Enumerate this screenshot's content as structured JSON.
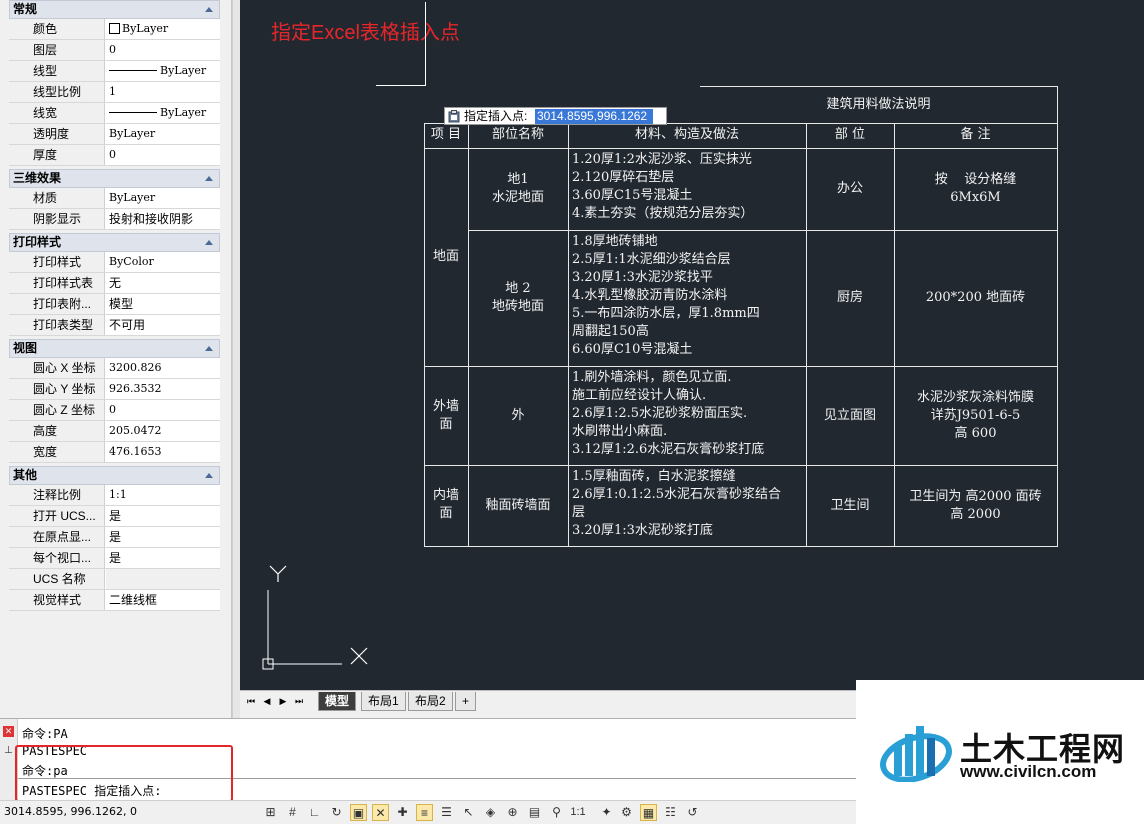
{
  "properties": {
    "sections": [
      {
        "title": "常规",
        "rows": [
          {
            "label": "颜色",
            "value": "ByLayer",
            "icon": "swatch"
          },
          {
            "label": "图层",
            "value": "0"
          },
          {
            "label": "线型",
            "value": "ByLayer",
            "icon": "line"
          },
          {
            "label": "线型比例",
            "value": "1"
          },
          {
            "label": "线宽",
            "value": "ByLayer",
            "icon": "line"
          },
          {
            "label": "透明度",
            "value": "ByLayer"
          },
          {
            "label": "厚度",
            "value": "0"
          }
        ]
      },
      {
        "title": "三维效果",
        "rows": [
          {
            "label": "材质",
            "value": "ByLayer"
          },
          {
            "label": "阴影显示",
            "value": "投射和接收阴影"
          }
        ]
      },
      {
        "title": "打印样式",
        "rows": [
          {
            "label": "打印样式",
            "value": "ByColor"
          },
          {
            "label": "打印样式表",
            "value": "无"
          },
          {
            "label": "打印表附...",
            "value": "模型"
          },
          {
            "label": "打印表类型",
            "value": "不可用"
          }
        ]
      },
      {
        "title": "视图",
        "rows": [
          {
            "label": "圆心 X 坐标",
            "value": "3200.826"
          },
          {
            "label": "圆心 Y 坐标",
            "value": "926.3532"
          },
          {
            "label": "圆心 Z 坐标",
            "value": "0"
          },
          {
            "label": "高度",
            "value": "205.0472"
          },
          {
            "label": "宽度",
            "value": "476.1653"
          }
        ]
      },
      {
        "title": "其他",
        "rows": [
          {
            "label": "注释比例",
            "value": "1:1"
          },
          {
            "label": "打开 UCS...",
            "value": "是"
          },
          {
            "label": "在原点显...",
            "value": "是"
          },
          {
            "label": "每个视口...",
            "value": "是"
          },
          {
            "label": "UCS 名称",
            "value": ""
          },
          {
            "label": "视觉样式",
            "value": "二维线框"
          }
        ]
      }
    ]
  },
  "canvas": {
    "annotation": "指定Excel表格插入点",
    "tooltip": {
      "label": "指定插入点:",
      "value": "3014.8595,996.1262"
    },
    "ucs": {
      "y_label": "Y",
      "x_label": "X"
    }
  },
  "table": {
    "title": "建筑用料做法说明",
    "headers": [
      "项 目",
      "部位名称",
      "材料、构造及做法",
      "部 位",
      "备 注"
    ],
    "rows": [
      {
        "group": "地面",
        "name": "地1\n水泥地面",
        "method": "1.20厚1:2水泥沙浆、压实抹光\n2.120厚碎石垫层\n3.60厚C15号混凝土\n4.素土夯实（按规范分层夯实）",
        "part": "办公",
        "note": "按    设分格缝\n6Mx6M"
      },
      {
        "group": "",
        "name": "地 2\n地砖地面",
        "method": "1.8厚地砖铺地\n2.5厚1:1水泥细沙浆结合层\n3.20厚1:3水泥沙浆找平\n4.水乳型橡胶沥青防水涂料\n5.一布四涂防水层，厚1.8mm四\n周翻起150高\n6.60厚C10号混凝土",
        "part": "厨房",
        "note": "200*200 地面砖"
      },
      {
        "group": "外墙\n面",
        "name": "外",
        "method": "1.刷外墙涂料，颜色见立面.\n施工前应经设计人确认.\n2.6厚1:2.5水泥砂浆粉面压实.\n水刷带出小麻面.\n3.12厚1:2.6水泥石灰膏砂浆打底",
        "part": "见立面图",
        "note": "水泥沙浆灰涂料饰膜\n详苏J9501-6-5\n高 600"
      },
      {
        "group": "内墙\n面",
        "name": "釉面砖墙面",
        "method": "1.5厚釉面砖，白水泥浆擦缝\n2.6厚1:0.1:2.5水泥石灰膏砂浆结合\n层\n3.20厚1:3水泥砂浆打底",
        "part": "卫生间",
        "note": "卫生间为 高2000 面砖\n高 2000"
      }
    ]
  },
  "tabs": {
    "items": [
      "模型",
      "布局1",
      "布局2",
      "+"
    ],
    "active": "模型"
  },
  "command": {
    "lines": [
      "命令:PA",
      "PASTESPEC",
      "命令:pa"
    ],
    "prompt": "PASTESPEC 指定插入点:"
  },
  "status": {
    "coords": "3014.8595, 996.1262, 0",
    "scale": "1:1"
  },
  "watermark": {
    "name": "土木工程网",
    "url": "www.civilcn.com"
  },
  "colors": {
    "canvas_bg": "#212830",
    "annotation": "#e8262a",
    "highlight": "#3a78d8"
  }
}
